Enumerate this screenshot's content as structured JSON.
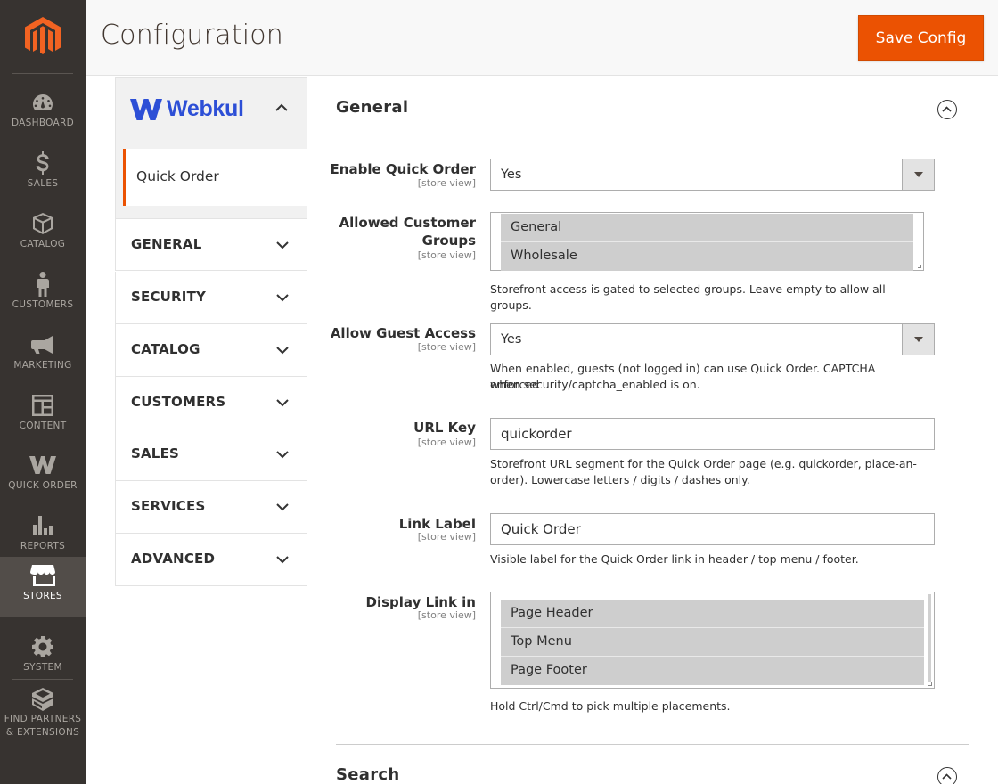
{
  "nav": {
    "items": [
      {
        "label": "DASHBOARD",
        "icon": "dashboard-icon"
      },
      {
        "label": "SALES",
        "icon": "dollar-icon"
      },
      {
        "label": "CATALOG",
        "icon": "box-icon"
      },
      {
        "label": "CUSTOMERS",
        "icon": "person-icon"
      },
      {
        "label": "MARKETING",
        "icon": "megaphone-icon"
      },
      {
        "label": "CONTENT",
        "icon": "layout-icon"
      },
      {
        "label": "QUICK ORDER",
        "icon": "webkul-w-icon"
      },
      {
        "label": "REPORTS",
        "icon": "bar-chart-icon"
      },
      {
        "label": "STORES",
        "icon": "store-icon",
        "active": true
      },
      {
        "label": "SYSTEM",
        "icon": "gear-icon"
      },
      {
        "label": "FIND PARTNERS",
        "label2": "& EXTENSIONS",
        "icon": "cube-icon"
      }
    ]
  },
  "header": {
    "title": "Configuration",
    "save_label": "Save Config"
  },
  "tabs": {
    "brand": "Webkul",
    "sub_item": "Quick Order",
    "sections": [
      "GENERAL",
      "SECURITY",
      "CATALOG",
      "CUSTOMERS",
      "SALES",
      "SERVICES",
      "ADVANCED"
    ]
  },
  "form": {
    "group_title": "General",
    "enable": {
      "label": "Enable Quick Order",
      "scope": "[store view]",
      "value": "Yes"
    },
    "groups": {
      "label_1": "Allowed Customer",
      "label_2": "Groups",
      "scope": "[store view]",
      "options": [
        "General",
        "Wholesale"
      ],
      "note": "Storefront access is gated to selected groups. Leave empty to allow all groups."
    },
    "guest": {
      "label": "Allow Guest Access",
      "scope": "[store view]",
      "value": "Yes",
      "note_1": "When enabled, guests (not logged in) can use Quick Order. CAPTCHA enforced",
      "note_2": "when security/captcha_enabled is on."
    },
    "url_key": {
      "label": "URL Key",
      "scope": "[store view]",
      "value": "quickorder",
      "note_1": "Storefront URL segment for the Quick Order page (e.g. quickorder, place-an-",
      "note_2": "order). Lowercase letters / digits / dashes only."
    },
    "link_label": {
      "label": "Link Label",
      "scope": "[store view]",
      "value": "Quick Order",
      "note": "Visible label for the Quick Order link in header / top menu / footer."
    },
    "display": {
      "label": "Display Link in",
      "scope": "[store view]",
      "options": [
        "Page Header",
        "Top Menu",
        "Page Footer"
      ],
      "note": "Hold Ctrl/Cmd to pick multiple placements."
    },
    "next_group_title": "Search"
  },
  "colors": {
    "accent": "#eb5202",
    "nav_bg": "#373330",
    "brand_blue": "#2d4fd6"
  }
}
